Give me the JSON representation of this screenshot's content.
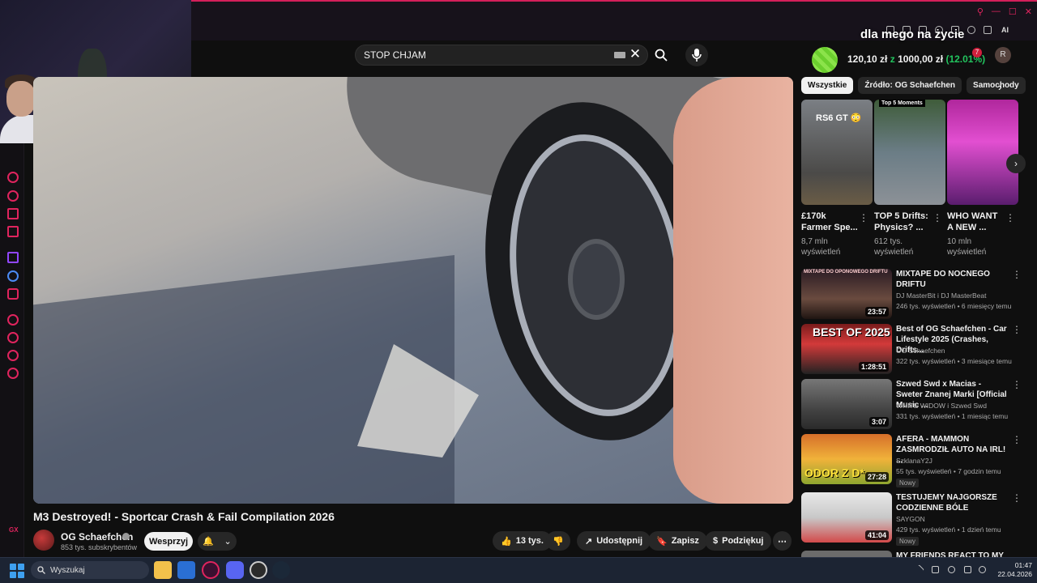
{
  "overlay": {
    "stream_text": "dla mego na życie",
    "wallet_amount": "120,10 zł",
    "wallet_sep": "z",
    "wallet_target": "1000,00 zł",
    "wallet_pct": "(12.01%)"
  },
  "header": {
    "search_value": "STOP CHJAM",
    "notif_count": "7",
    "avatar_letter": "R",
    "ai_label": "AI"
  },
  "video": {
    "title": "M3 Destroyed! - Sportcar Crash & Fail Compilation 2026",
    "channel": "OG Schaefchen",
    "subscribers": "853 tys. subskrybentów",
    "support_label": "Wesprzyj",
    "likes": "13 tys.",
    "share_label": "Udostępnij",
    "save_label": "Zapisz",
    "thanks_label": "Podziękuj"
  },
  "chips": [
    "Wszystkie",
    "Źródło: OG Schaefchen",
    "Samochody"
  ],
  "shorts": [
    {
      "label": "RS6 GT 😳",
      "title": "£170k Farmer Spe...",
      "views": "8,7 mln wyświetleń"
    },
    {
      "label": "Top 5 Moments",
      "title": "TOP 5 Drifts: Physics? ...",
      "views": "612 tys. wyświetleń"
    },
    {
      "label": "",
      "title": "WHO WANT A NEW ...",
      "views": "10 mln wyświetleń"
    }
  ],
  "recommendations": [
    {
      "thumb": "MIXTAPE DO OPONOWEGO DRIFTU",
      "title": "MIXTAPE DO NOCNEGO DRIFTU",
      "channel": "DJ MasterBit i DJ MasterBeat",
      "meta": "246 tys. wyświetleń • 6 miesięcy temu",
      "duration": "23:57",
      "badge": ""
    },
    {
      "thumb": "BEST OF 2025",
      "title": "Best of OG Schaefchen - Car Lifestyle 2025 (Crashes, Drifts...",
      "channel": "OG Schaefchen",
      "meta": "322 tys. wyświetleń • 3 miesiące temu",
      "duration": "1:28:51",
      "badge": ""
    },
    {
      "thumb": "",
      "title": "Szwed Swd x Macias - Sweter Znanej Marki [Official Music ...",
      "channel": "WHITE WIDOW i Szwed Swd",
      "meta": "331 tys. wyświetleń • 1 miesiąc temu",
      "duration": "3:07",
      "badge": ""
    },
    {
      "thumb": "ODOR Z D*",
      "title": "AFERA - MAMMON ZASMRODZIŁ AUTO NA IRL! ...",
      "channel": "SzklanaY2J",
      "meta": "55 tys. wyświetleń • 7 godzin temu",
      "duration": "27:28",
      "badge": "Nowy"
    },
    {
      "thumb": "",
      "title": "TESTUJEMY NAJGORSZE CODZIENNE BÓLE",
      "channel": "SAYGON",
      "meta": "429 tys. wyświetleń • 1 dzień temu",
      "duration": "41:04",
      "badge": "Nowy"
    },
    {
      "thumb": "",
      "title": "MY FRIENDS REACT TO MY ...",
      "channel": "",
      "meta": "",
      "duration": "",
      "badge": ""
    }
  ],
  "taskbar": {
    "search_placeholder": "Wyszukaj",
    "time": "01:47",
    "date": "22.04.2026"
  },
  "sidebar": {
    "gx": "GX"
  },
  "colors": {
    "accent": "#e0245e",
    "yt_bg": "#0f0f0f",
    "wallet_green": "#22c55e"
  }
}
